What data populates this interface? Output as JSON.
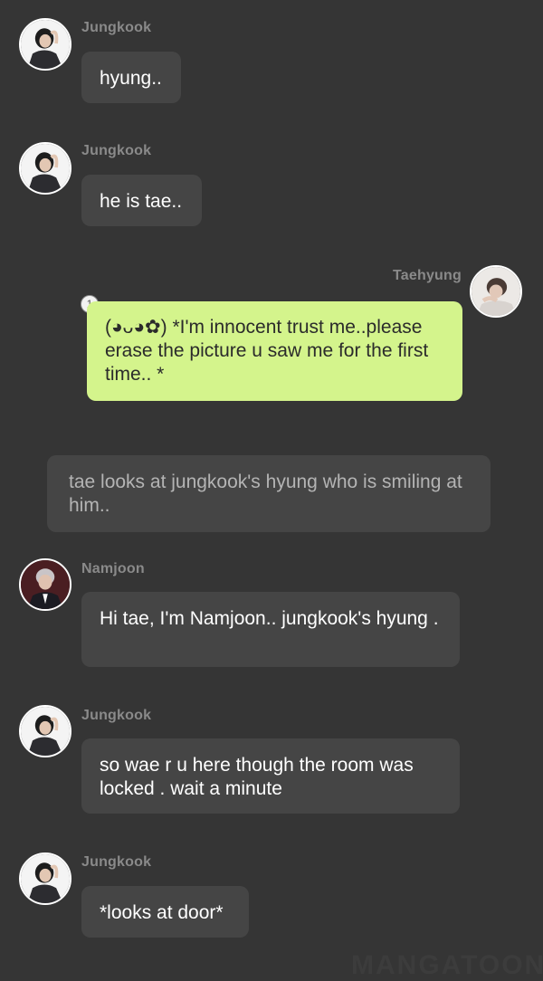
{
  "messages": [
    {
      "sender": "Jungkook",
      "text": "hyung.."
    },
    {
      "sender": "Jungkook",
      "text": "he is tae.."
    },
    {
      "sender": "Taehyung",
      "text": "(◕ᴗ◕✿) *I'm innocent trust me..please erase the picture u saw me for the first time.. *",
      "read_count": "1"
    },
    {
      "narration": "tae looks at jungkook's hyung who is smiling at him.."
    },
    {
      "sender": "Namjoon",
      "text": "Hi  tae, I'm Namjoon.. jungkook's hyung ."
    },
    {
      "sender": "Jungkook",
      "text": "so wae r u here though the room was locked . wait a minute"
    },
    {
      "sender": "Jungkook",
      "text": "*looks at door*"
    }
  ],
  "watermark": "MANGATOON",
  "colors": {
    "background": "#353535",
    "bubble": "#454545",
    "own_bubble": "#d4f48c",
    "name": "#8a8a8a"
  }
}
